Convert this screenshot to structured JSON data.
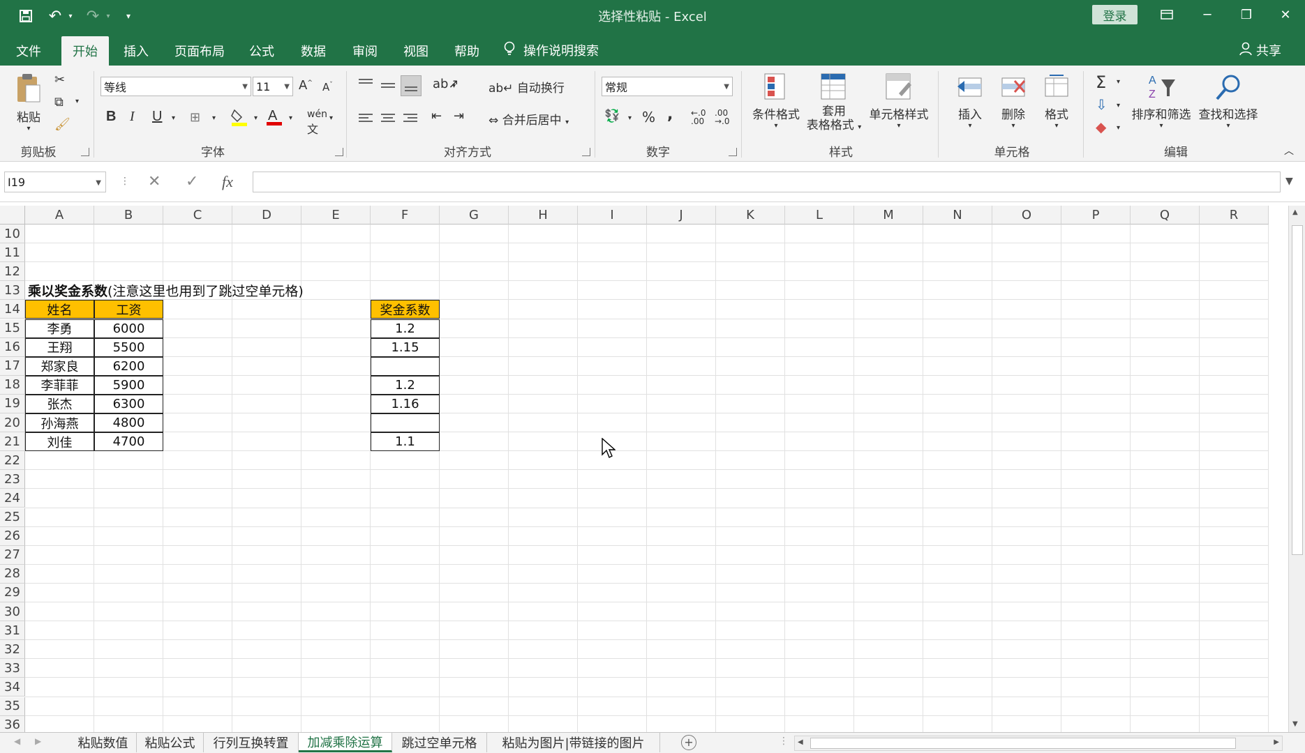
{
  "window": {
    "title": "选择性粘贴  -  Excel",
    "login_label": "登录"
  },
  "tabs": [
    {
      "label": "文件"
    },
    {
      "label": "开始"
    },
    {
      "label": "插入"
    },
    {
      "label": "页面布局"
    },
    {
      "label": "公式"
    },
    {
      "label": "数据"
    },
    {
      "label": "审阅"
    },
    {
      "label": "视图"
    },
    {
      "label": "帮助"
    }
  ],
  "tell_me": "操作说明搜索",
  "share": "共享",
  "ribbon": {
    "clipboard": {
      "paste": "粘贴",
      "label": "剪贴板"
    },
    "font": {
      "name": "等线",
      "size": "11",
      "label": "字体",
      "bold": "B",
      "italic": "I",
      "underline": "U"
    },
    "alignment": {
      "wrap": "自动换行",
      "merge": "合并后居中",
      "label": "对齐方式"
    },
    "number": {
      "format": "常规",
      "label": "数字",
      "percent": "%",
      "comma": ","
    },
    "styles": {
      "conditional": "条件格式",
      "table_line1": "套用",
      "table_line2": "表格格式",
      "cell_styles": "单元格样式",
      "label": "样式"
    },
    "cells": {
      "insert": "插入",
      "delete": "删除",
      "format": "格式",
      "label": "单元格"
    },
    "editing": {
      "sort": "排序和筛选",
      "find": "查找和选择",
      "label": "编辑"
    }
  },
  "formula_bar": {
    "name_box": "I19",
    "fx": "fx",
    "value": ""
  },
  "columns": [
    "A",
    "B",
    "C",
    "D",
    "E",
    "F",
    "G",
    "H",
    "I",
    "J",
    "K",
    "L",
    "M",
    "N",
    "O",
    "P",
    "Q",
    "R"
  ],
  "rows": [
    "10",
    "11",
    "12",
    "13",
    "14",
    "15",
    "16",
    "17",
    "18",
    "19",
    "20",
    "21",
    "22",
    "23",
    "24",
    "25",
    "26",
    "27",
    "28",
    "29",
    "30",
    "31",
    "32",
    "33",
    "34",
    "35",
    "36"
  ],
  "sheet": {
    "title_bold": "乘以奖金系数",
    "title_rest": "(注意这里也用到了跳过空单元格)",
    "table_headers": [
      "姓名",
      "工资"
    ],
    "table_rows": [
      [
        "李勇",
        "6000"
      ],
      [
        "王翔",
        "5500"
      ],
      [
        "郑家良",
        "6200"
      ],
      [
        "李菲菲",
        "5900"
      ],
      [
        "张杰",
        "6300"
      ],
      [
        "孙海燕",
        "4800"
      ],
      [
        "刘佳",
        "4700"
      ]
    ],
    "coef_header": "奖金系数",
    "coef_values": [
      "1.2",
      "1.15",
      "",
      "1.2",
      "1.16",
      "",
      "1.1"
    ]
  },
  "sheet_tabs": [
    {
      "label": "粘贴数值"
    },
    {
      "label": "粘贴公式"
    },
    {
      "label": "行列互换转置"
    },
    {
      "label": "加减乘除运算"
    },
    {
      "label": "跳过空单元格"
    },
    {
      "label": "粘贴为图片|带链接的图片"
    }
  ],
  "colors": {
    "accent": "#217346",
    "header_fill": "#ffc000"
  }
}
